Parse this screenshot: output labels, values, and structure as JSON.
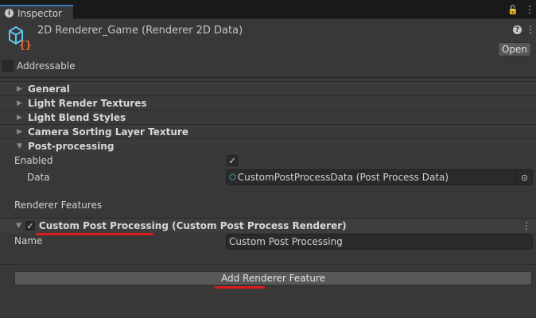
{
  "tab": {
    "label": "Inspector"
  },
  "header": {
    "title": "2D Renderer_Game (Renderer 2D Data)",
    "open_label": "Open",
    "addressable_label": "Addressable"
  },
  "foldouts": [
    {
      "label": "General"
    },
    {
      "label": "Light Render Textures"
    },
    {
      "label": "Light Blend Styles"
    },
    {
      "label": "Camera Sorting Layer Texture"
    },
    {
      "label": "Post-processing"
    }
  ],
  "post": {
    "enabled_label": "Enabled",
    "enabled": true,
    "data_label": "Data",
    "data_value": "CustomPostProcessData (Post Process Data)"
  },
  "features": {
    "section_label": "Renderer Features",
    "feature_title": "Custom Post Processing (Custom Post Process Renderer)",
    "name_label": "Name",
    "name_value": "Custom Post Processing",
    "add_button": "Add Renderer Feature"
  },
  "colors": {
    "accent": "#3a79bb",
    "annotation": "#e01b1b"
  }
}
